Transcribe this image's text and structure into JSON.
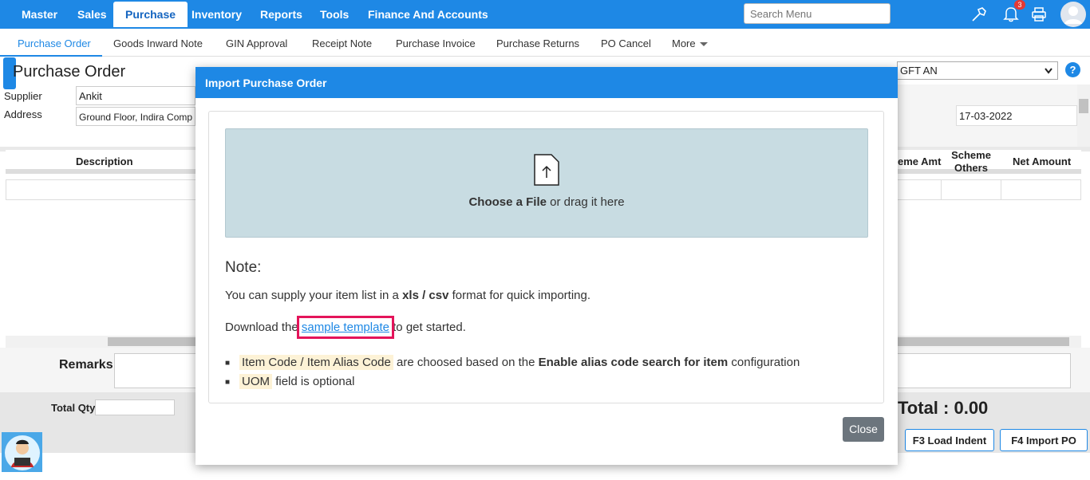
{
  "top_nav": {
    "items": [
      "Master",
      "Sales",
      "Purchase",
      "Inventory",
      "Reports",
      "Tools",
      "Finance And Accounts"
    ],
    "search_placeholder": "Search Menu",
    "notification_count": "3"
  },
  "sub_nav": {
    "items": [
      "Purchase Order",
      "Goods Inward Note",
      "GIN Approval",
      "Receipt Note",
      "Purchase Invoice",
      "Purchase Returns",
      "PO Cancel",
      "More"
    ]
  },
  "page": {
    "title": "Purchase Order",
    "supplier_label": "Supplier",
    "supplier_value": "Ankit",
    "address_label": "Address",
    "address_value": "Ground Floor, Indira Comp",
    "branch_select": "GFT AN",
    "date": "17-03-2022",
    "columns": {
      "description": "Description",
      "scheme_amt": "eme Amt",
      "scheme_others": "Scheme Others",
      "net_amount": "Net Amount"
    },
    "remarks_label": "Remarks",
    "total_qty_label": "Total Qty",
    "total_label": "Total : 0.00",
    "load_indent_button": "F3 Load Indent",
    "import_po_button": "F4 Import PO"
  },
  "modal": {
    "title": "Import Purchase Order",
    "drop_bold": "Choose a File",
    "drop_rest": " or drag it here",
    "note_heading": "Note:",
    "line1_pre": "You can supply your item list in a ",
    "line1_bold": "xls / csv",
    "line1_post": " format for quick importing.",
    "line2_pre": "Download the ",
    "line2_link": "sample template",
    "line2_post": " to get started.",
    "bullet1_code": "Item Code / Item Alias Code",
    "bullet1_mid": " are choosed based on the ",
    "bullet1_bold": "Enable alias code search for item",
    "bullet1_post": " configuration",
    "bullet2_code": "UOM",
    "bullet2_post": " field is optional",
    "close_button": "Close"
  }
}
